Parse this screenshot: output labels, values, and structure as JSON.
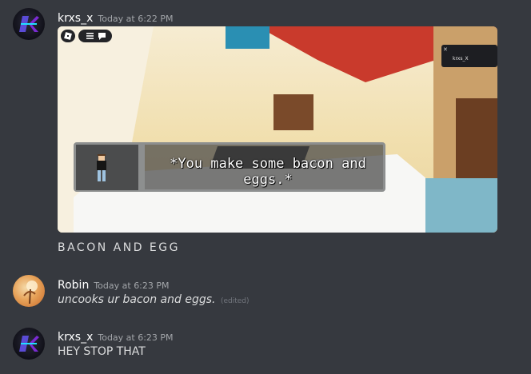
{
  "messages": [
    {
      "username": "krxs_x",
      "timestamp": "Today at 6:22 PM",
      "attachment": {
        "overlay_tag": "krxs_X",
        "dialogue": "*You make some bacon and eggs.*"
      },
      "text": "BACON AND EGG"
    },
    {
      "username": "Robin",
      "timestamp": "Today at 6:23 PM",
      "text": "uncooks ur bacon and eggs.",
      "edited": "(edited)"
    },
    {
      "username": "krxs_x",
      "timestamp": "Today at 6:23 PM",
      "text": "HEY STOP THAT"
    }
  ],
  "colors": {
    "background": "#36393f",
    "username": "#ffffff",
    "timestamp": "#a3a6aa",
    "text": "#dcddde",
    "edited": "#72767d"
  },
  "icons": [
    "krxs-avatar",
    "robin-avatar",
    "roblox-logo-icon",
    "menu-icon",
    "chat-icon",
    "close-icon"
  ]
}
